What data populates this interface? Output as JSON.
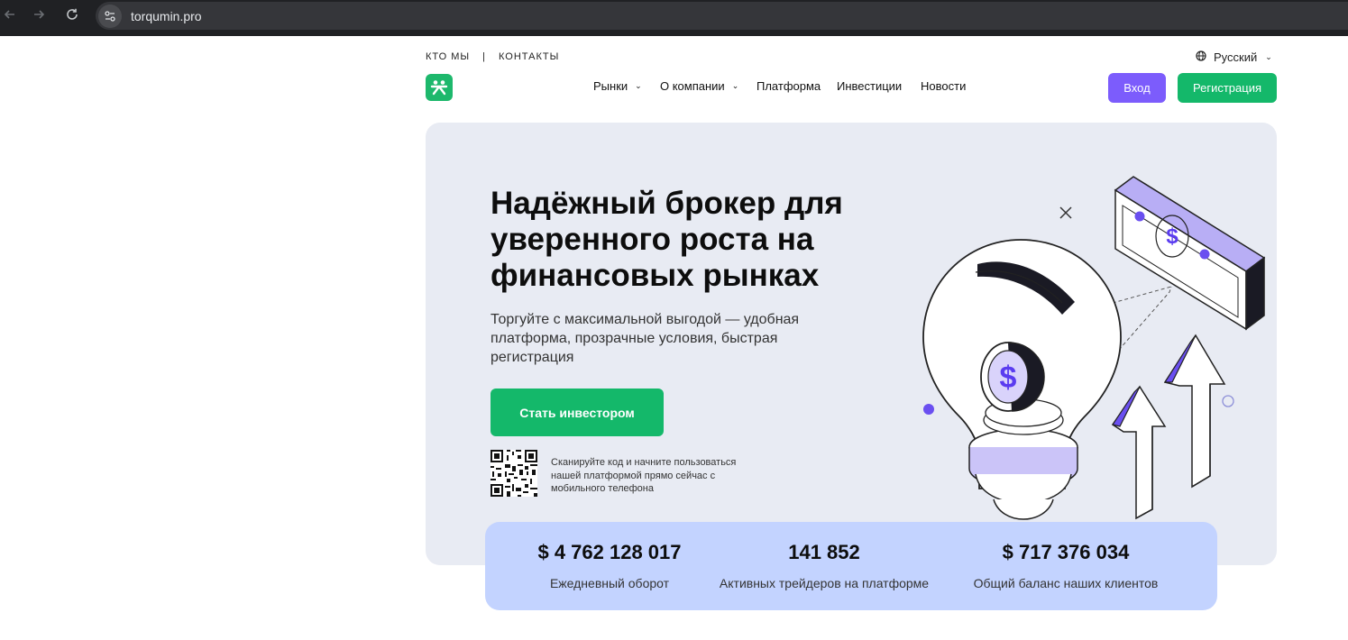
{
  "browser": {
    "url": "torqumin.pro"
  },
  "topnav": {
    "about": "КТО МЫ",
    "separator": "|",
    "contacts": "КОНТАКТЫ"
  },
  "language": {
    "label": "Русский"
  },
  "mainnav": {
    "items": [
      {
        "label": "Рынки",
        "has_dropdown": true
      },
      {
        "label": "О компании",
        "has_dropdown": true
      },
      {
        "label": "Платформа",
        "has_dropdown": false
      },
      {
        "label": "Инвестиции",
        "has_dropdown": false
      },
      {
        "label": "Новости",
        "has_dropdown": false
      }
    ]
  },
  "auth": {
    "login": "Вход",
    "register": "Регистрация"
  },
  "hero": {
    "title": "Надёжный брокер для уверенного роста на финансовых рынках",
    "subtitle": "Торгуйте с максимальной выгодой — удобная платформа, прозрачные условия, быстрая регистрация",
    "cta": "Стать инвестором",
    "qr_text": "Сканируйте код и начните пользоваться нашей платформой прямо сейчас с мобильного телефона"
  },
  "stats": [
    {
      "value": "$ 4 762 128 017",
      "label": "Ежедневный оборот"
    },
    {
      "value": "141 852",
      "label": "Активных трейдеров на платформе"
    },
    {
      "value": "$ 717 376 034",
      "label": "Общий баланс наших клиентов"
    }
  ],
  "colors": {
    "brand_green": "#14b86a",
    "accent_purple": "#7c5cfc",
    "hero_bg": "#e8ebf3",
    "stats_bg": "#c3d3ff",
    "browser_bg": "#202124"
  }
}
